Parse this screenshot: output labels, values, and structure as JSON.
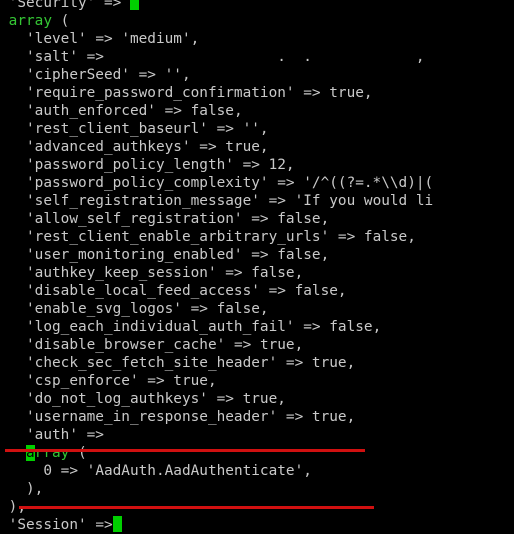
{
  "terminal": {
    "lines": [
      {
        "indent": 1,
        "key": "'Security'",
        "op": " => ",
        "cursor": true
      },
      {
        "indent": 1,
        "kw": "array",
        "rest": " ("
      },
      {
        "indent": 2,
        "key": "'level'",
        "op": " => ",
        "val": "'medium',"
      },
      {
        "indent": 2,
        "key": "'salt'",
        "op": " =>",
        "val": "                    .  .            ,"
      },
      {
        "indent": 2,
        "key": "'cipherSeed'",
        "op": " => ",
        "val": "'',"
      },
      {
        "indent": 2,
        "key": "'require_password_confirmation'",
        "op": " => ",
        "val": "true,"
      },
      {
        "indent": 2,
        "key": "'auth_enforced'",
        "op": " => ",
        "val": "false,"
      },
      {
        "indent": 2,
        "key": "'rest_client_baseurl'",
        "op": " => ",
        "val": "'',"
      },
      {
        "indent": 2,
        "key": "'advanced_authkeys'",
        "op": " => ",
        "val": "true,"
      },
      {
        "indent": 2,
        "key": "'password_policy_length'",
        "op": " => ",
        "val": "12,"
      },
      {
        "indent": 2,
        "key": "'password_policy_complexity'",
        "op": " => ",
        "val": "'/^((?=.*\\\\d)|("
      },
      {
        "indent": 2,
        "key": "'self_registration_message'",
        "op": " => ",
        "val": "'If you would li"
      },
      {
        "indent": 2,
        "key": "'allow_self_registration'",
        "op": " => ",
        "val": "false,"
      },
      {
        "indent": 2,
        "key": "'rest_client_enable_arbitrary_urls'",
        "op": " => ",
        "val": "false,"
      },
      {
        "indent": 2,
        "key": "'user_monitoring_enabled'",
        "op": " => ",
        "val": "false,"
      },
      {
        "indent": 2,
        "key": "'authkey_keep_session'",
        "op": " => ",
        "val": "false,"
      },
      {
        "indent": 2,
        "key": "'disable_local_feed_access'",
        "op": " => ",
        "val": "false,"
      },
      {
        "indent": 2,
        "key": "'enable_svg_logos'",
        "op": " => ",
        "val": "false,"
      },
      {
        "indent": 2,
        "key": "'log_each_individual_auth_fail'",
        "op": " => ",
        "val": "false,"
      },
      {
        "indent": 2,
        "key": "'disable_browser_cache'",
        "op": " => ",
        "val": "true,"
      },
      {
        "indent": 2,
        "key": "'check_sec_fetch_site_header'",
        "op": " => ",
        "val": "true,"
      },
      {
        "indent": 2,
        "key": "'csp_enforce'",
        "op": " => ",
        "val": "true,"
      },
      {
        "indent": 2,
        "key": "'do_not_log_authkeys'",
        "op": " => ",
        "val": "true,"
      },
      {
        "indent": 2,
        "key": "'username_in_response_header'",
        "op": " => ",
        "val": "true,"
      },
      {
        "indent": 2,
        "key": "'auth'",
        "op": " =>"
      },
      {
        "indent": 2,
        "kw_cursor_a": "a",
        "kw": "rray",
        "rest": " ("
      },
      {
        "indent": 3,
        "key": "0",
        "op": " => ",
        "val": "'AadAuth.AadAuthenticate',"
      },
      {
        "indent": 2,
        "rest": "),"
      },
      {
        "indent": 1,
        "rest": "),"
      },
      {
        "indent": 1,
        "key": "'Session'",
        "op": " =>",
        "cursor": true
      }
    ]
  },
  "colors": {
    "background": "#000000",
    "text": "#c9c9c9",
    "keyword": "#34c634",
    "cursor": "#00d000",
    "annotation": "#d01010"
  }
}
